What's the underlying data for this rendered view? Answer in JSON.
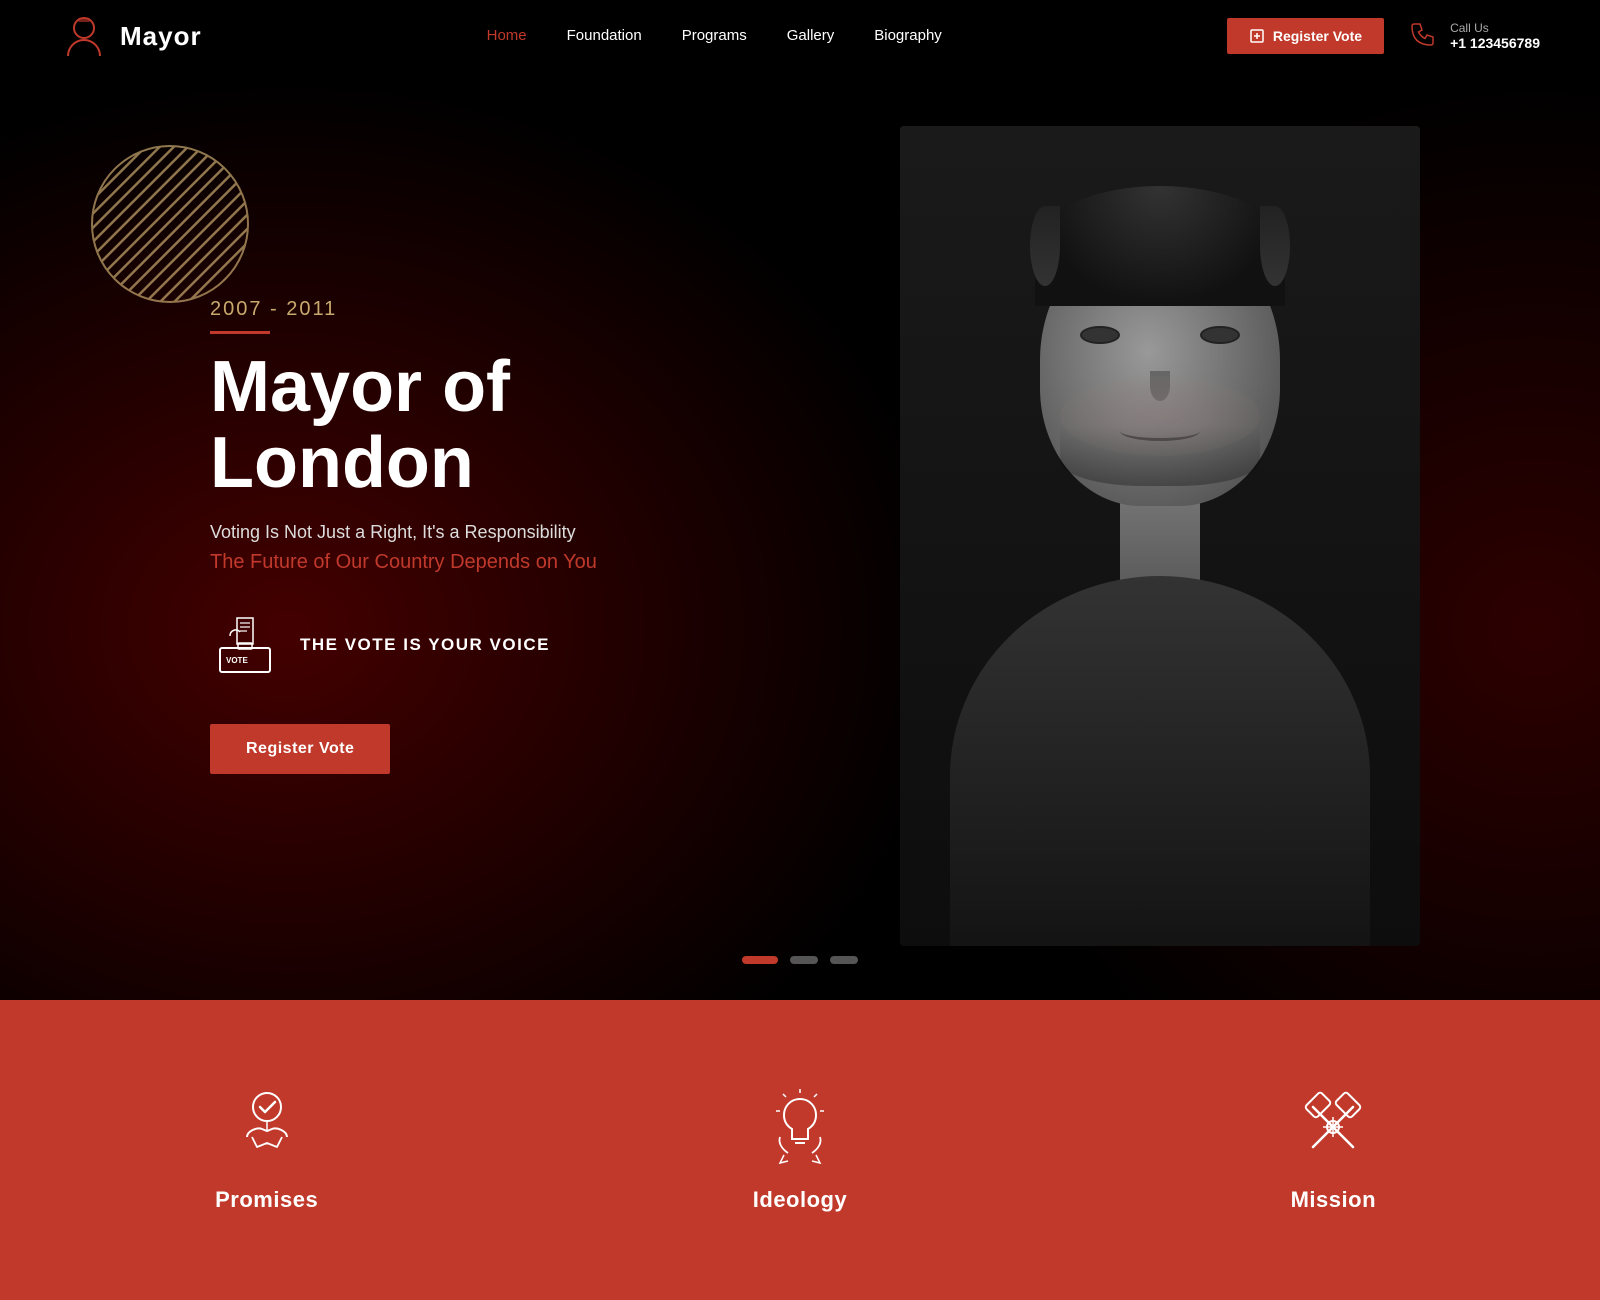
{
  "brand": {
    "name": "Mayor",
    "icon_label": "mayor-icon"
  },
  "nav": {
    "links": [
      {
        "label": "Home",
        "active": true,
        "id": "home"
      },
      {
        "label": "Foundation",
        "active": false,
        "id": "foundation"
      },
      {
        "label": "Programs",
        "active": false,
        "id": "programs"
      },
      {
        "label": "Gallery",
        "active": false,
        "id": "gallery"
      },
      {
        "label": "Biography",
        "active": false,
        "id": "biography"
      }
    ],
    "register_btn": "Register Vote",
    "call_label": "Call Us",
    "call_number": "+1 123456789"
  },
  "hero": {
    "year_range": "2007 - 2011",
    "title": "Mayor of London",
    "subtitle": "Voting Is Not Just a Right, It's a Responsibility",
    "tagline": "The Future of Our Country Depends on You",
    "vote_text": "THE VOTE IS YOUR VOICE",
    "register_btn": "Register Vote"
  },
  "slider": {
    "dots": [
      {
        "active": true
      },
      {
        "active": false
      },
      {
        "active": false
      }
    ]
  },
  "bottom": {
    "cards": [
      {
        "label": "Promises",
        "icon": "promises-icon"
      },
      {
        "label": "Ideology",
        "icon": "ideology-icon"
      },
      {
        "label": "Mission",
        "icon": "mission-icon"
      }
    ]
  },
  "colors": {
    "red": "#c0392b",
    "gold": "#c8a96e",
    "dark": "#000000"
  }
}
